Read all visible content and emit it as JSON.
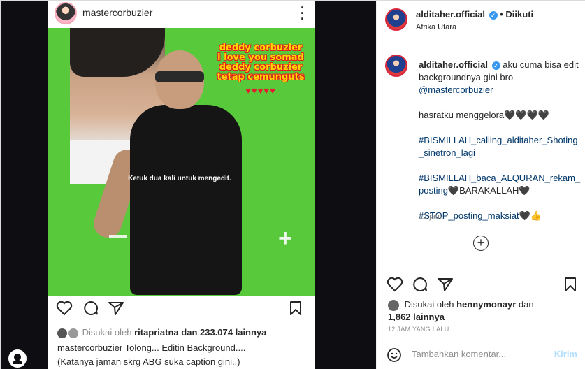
{
  "post_image": {
    "author": "mastercorbuzier",
    "overlay_lines": [
      "deddy corbuzier",
      "i love you somad",
      "deddy corbuzier",
      "tetap cemunguts"
    ],
    "hearts": "♥♥♥♥♥",
    "edit_hint": "Ketuk dua kali untuk mengedit.",
    "liked_prefix": "Disukai oleh",
    "liked_user": "ritapriatna",
    "liked_suffix": "dan 233.074 lainnya",
    "caption_user": "mastercorbuzier",
    "caption_text": "Tolong... Editin Background....",
    "caption_line2": "(Katanya jaman skrg ABG suka caption gini..)"
  },
  "header": {
    "username": "alditaher.official",
    "separator": "•",
    "follow_status": "Diikuti",
    "location": "Afrika Utara"
  },
  "caption": {
    "username": "alditaher.official",
    "text1": "aku cuma bisa edit backgroundnya gini bro",
    "mention": "@mastercorbuzier",
    "line2": "hasratku menggelora🖤🖤🖤🖤",
    "tag1": "#BISMILLAH_calling_alditaher_Shoting _sinetron_lagi",
    "tag2a": "#BISMILLAH_baca_ALQURAN_rekam_ posting",
    "tag2b": "🖤BARAKALLAH🖤",
    "tag3": "#STOP_posting_maksiat",
    "tag3_end": "🖤👍",
    "time": "12 jam"
  },
  "likes": {
    "prefix": "Disukai oleh",
    "user": "hennymonayr",
    "mid": "dan",
    "count": "1,862 lainnya",
    "timestamp": "12 JAM YANG LALU"
  },
  "comment": {
    "placeholder": "Tambahkan komentar...",
    "post_label": "Kirim"
  }
}
